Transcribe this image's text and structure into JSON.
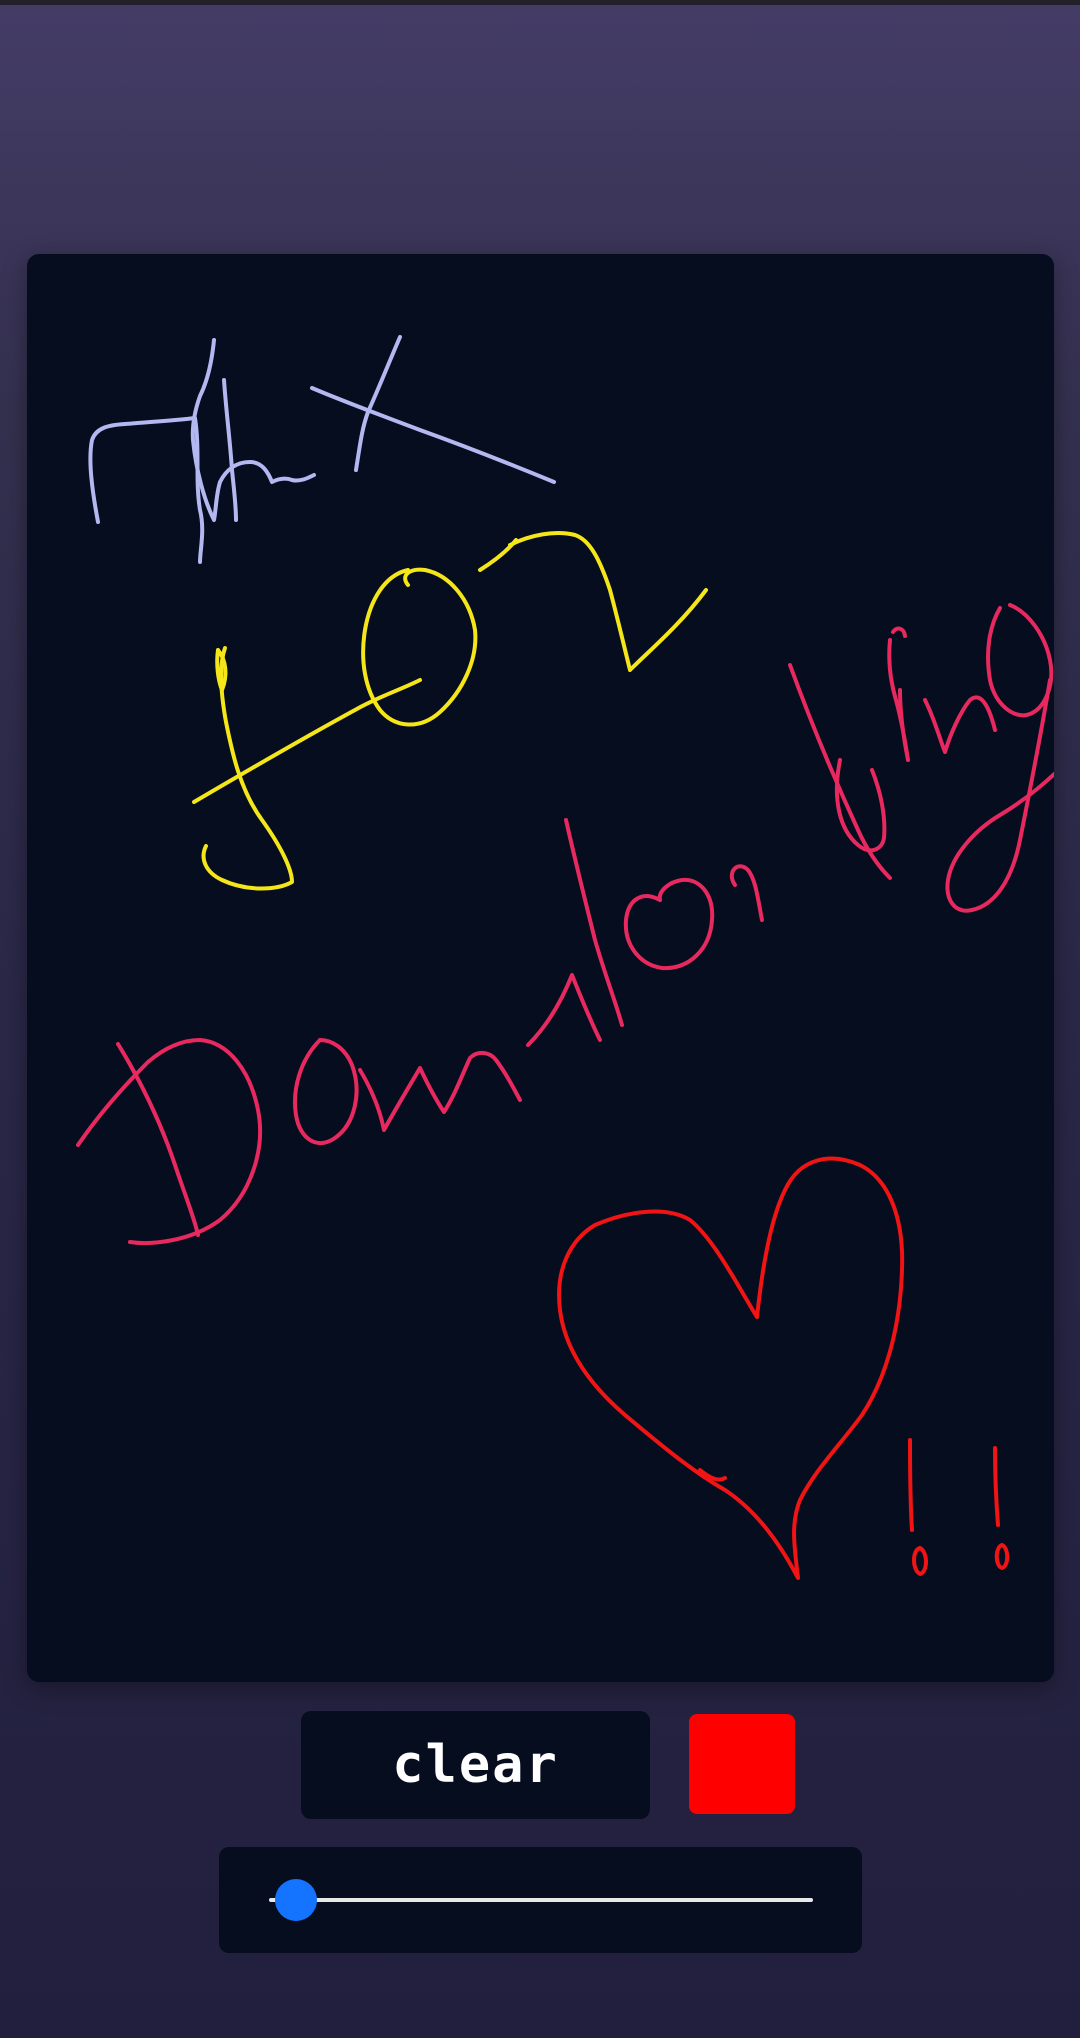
{
  "toolbar": {
    "clear_label": "clear",
    "current_color": "#ff0000"
  },
  "brush_size_slider": {
    "value_fraction": 0.05
  },
  "canvas": {
    "background": "#050d1f",
    "strokes": [
      {
        "name": "thx-handwriting",
        "color": "#b3b8f0"
      },
      {
        "name": "for-handwriting",
        "color": "#f5e61a"
      },
      {
        "name": "downloading-handwriting",
        "color": "#e8295f"
      },
      {
        "name": "heart-drawing",
        "color": "#f01414"
      },
      {
        "name": "exclamation-marks",
        "color": "#f01414"
      }
    ]
  }
}
